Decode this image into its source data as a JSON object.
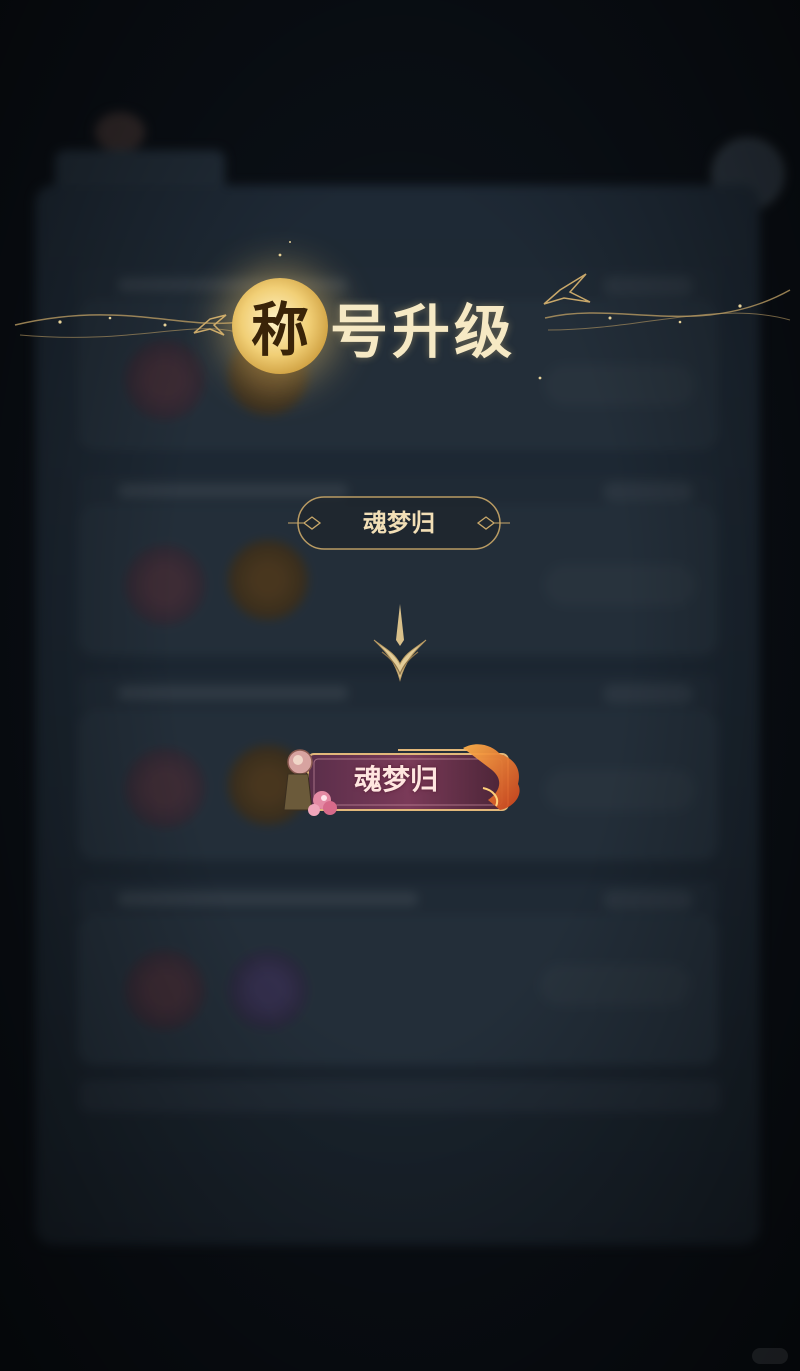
{
  "popup": {
    "title_first_char": "称",
    "title_rest": "号升级",
    "old_title": "魂梦归",
    "new_title": "魂梦归"
  },
  "icons": {
    "arrow": "down-arrow-icon",
    "ornament": "diamond-ornament-icon",
    "bird": "swallow-icon"
  },
  "colors": {
    "gold": "#d9b46a",
    "title_text": "#f6e9c4",
    "badge_pink": "#b8577a",
    "badge_flame": "#e0662a"
  }
}
